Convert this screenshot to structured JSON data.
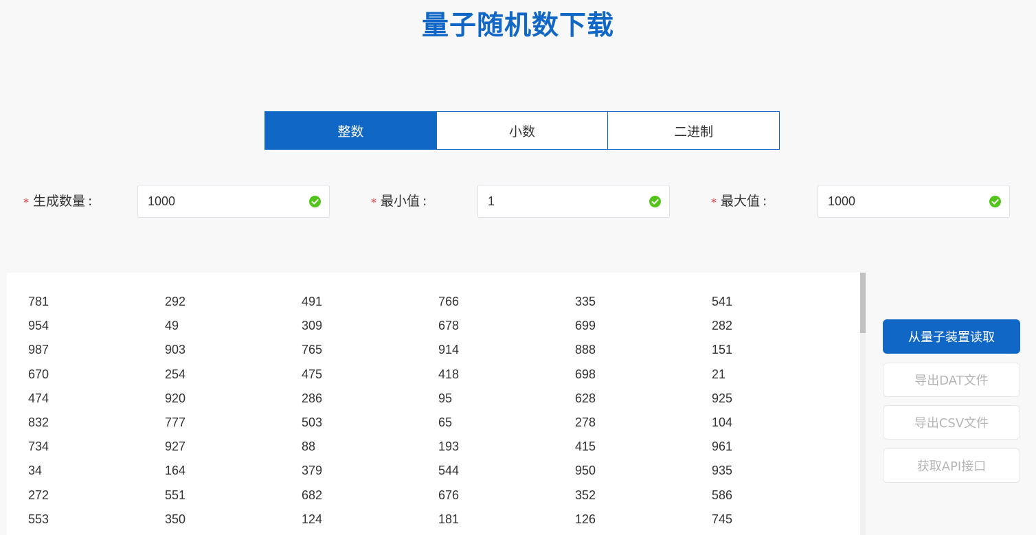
{
  "title": "量子随机数下载",
  "tabs": [
    {
      "label": "整数",
      "active": true
    },
    {
      "label": "小数",
      "active": false
    },
    {
      "label": "二进制",
      "active": false
    }
  ],
  "form": {
    "required_mark": "*",
    "colon": ":",
    "count": {
      "label": "生成数量",
      "value": "1000"
    },
    "min": {
      "label": "最小值",
      "value": "1"
    },
    "max": {
      "label": "最大值",
      "value": "1000"
    }
  },
  "numbers": [
    [
      "781",
      "292",
      "491",
      "766",
      "335",
      "541"
    ],
    [
      "954",
      "49",
      "309",
      "678",
      "699",
      "282"
    ],
    [
      "987",
      "903",
      "765",
      "914",
      "888",
      "151"
    ],
    [
      "670",
      "254",
      "475",
      "418",
      "698",
      "21"
    ],
    [
      "474",
      "920",
      "286",
      "95",
      "628",
      "925"
    ],
    [
      "832",
      "777",
      "503",
      "65",
      "278",
      "104"
    ],
    [
      "734",
      "927",
      "88",
      "193",
      "415",
      "961"
    ],
    [
      "34",
      "164",
      "379",
      "544",
      "950",
      "935"
    ],
    [
      "272",
      "551",
      "682",
      "676",
      "352",
      "586"
    ],
    [
      "553",
      "350",
      "124",
      "181",
      "126",
      "745"
    ]
  ],
  "actions": {
    "read": "从量子装置读取",
    "export_dat": "导出DAT文件",
    "export_csv": "导出CSV文件",
    "api": "获取API接口"
  },
  "colors": {
    "primary": "#1167c6",
    "success": "#52c41a",
    "required": "#e4393c",
    "disabled_text": "#b5b5b5"
  }
}
